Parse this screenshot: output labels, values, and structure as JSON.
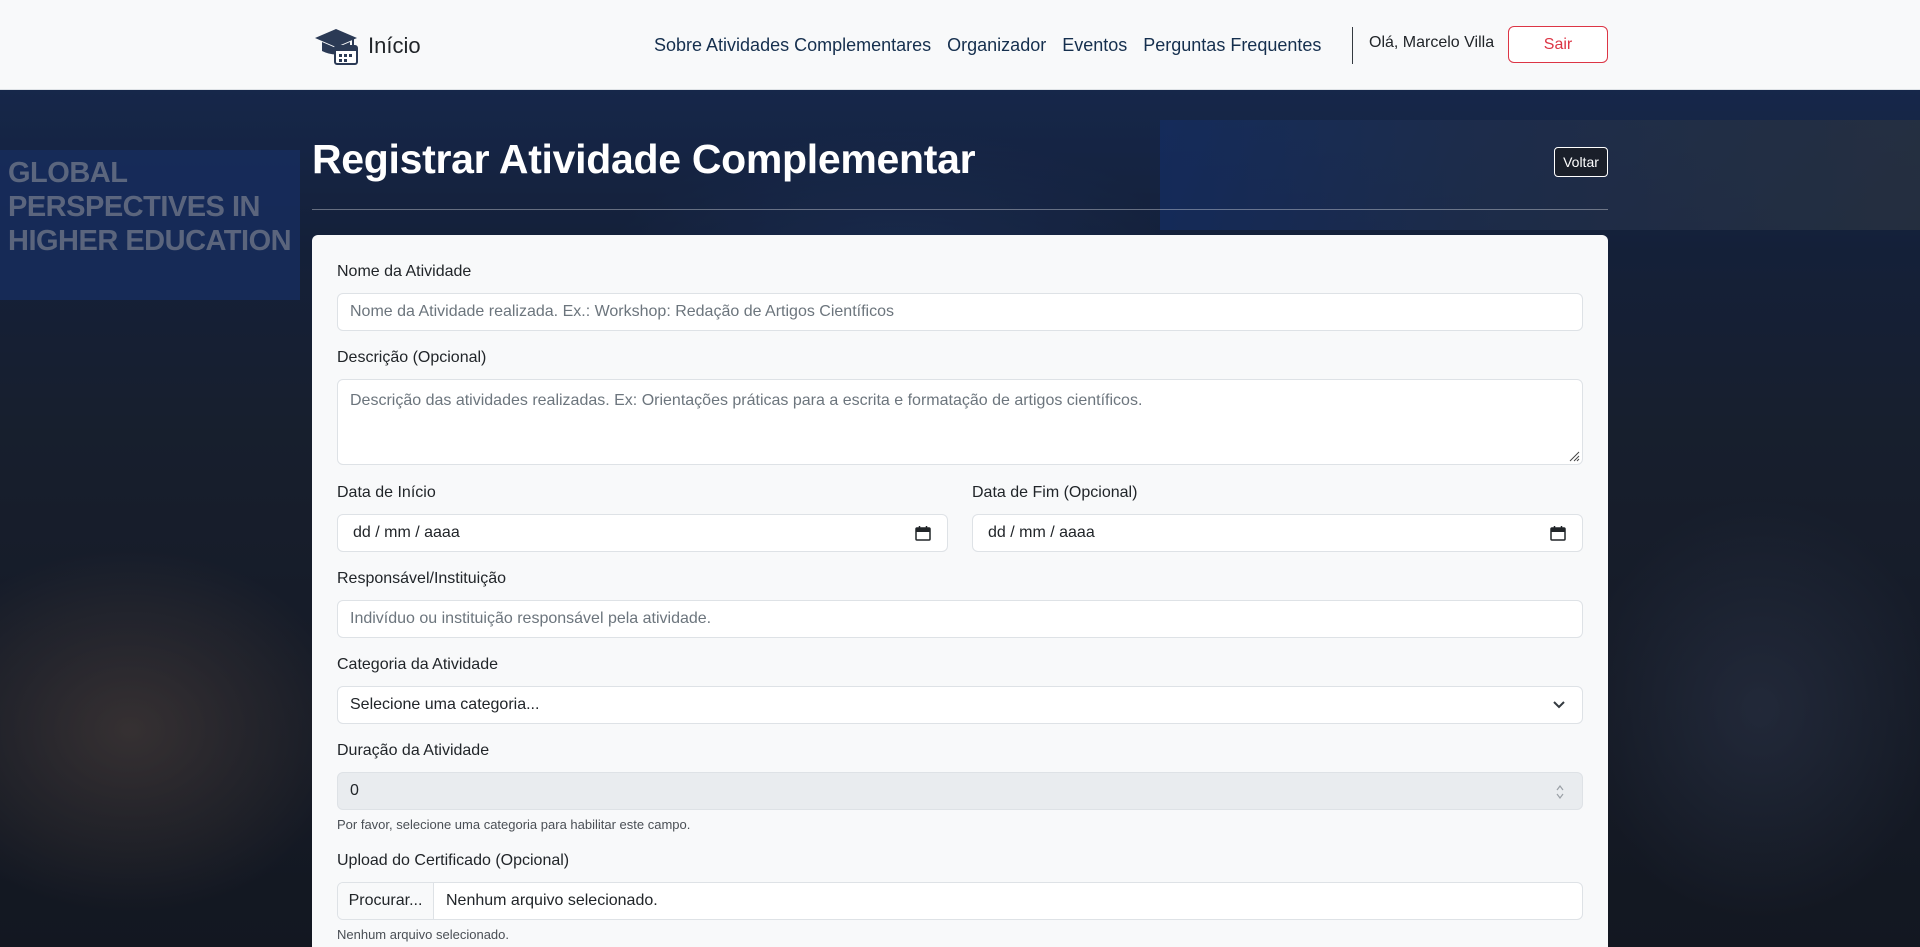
{
  "navbar": {
    "brand_label": "Início",
    "links": [
      "Sobre Atividades Complementares",
      "Organizador",
      "Eventos",
      "Perguntas Frequentes"
    ],
    "greeting": "Olá, Marcelo Villa",
    "logout_label": "Sair"
  },
  "background": {
    "banner_lines": [
      "GLOBAL",
      "PERSPECTIVES IN",
      "HIGHER EDUCATION"
    ]
  },
  "page": {
    "title": "Registrar Atividade Complementar",
    "back_label": "Voltar"
  },
  "form": {
    "name": {
      "label": "Nome da Atividade",
      "placeholder": "Nome da Atividade realizada. Ex.: Workshop: Redação de Artigos Científicos"
    },
    "description": {
      "label": "Descrição (Opcional)",
      "placeholder": "Descrição das atividades realizadas. Ex: Orientações práticas para a escrita e formatação de artigos científicos."
    },
    "start_date": {
      "label": "Data de Início",
      "value": "dd / mm / aaaa"
    },
    "end_date": {
      "label": "Data de Fim (Opcional)",
      "value": "dd / mm / aaaa"
    },
    "responsible": {
      "label": "Responsável/Instituição",
      "placeholder": "Indivíduo ou instituição responsável pela atividade."
    },
    "category": {
      "label": "Categoria da Atividade",
      "selected": "Selecione uma categoria..."
    },
    "duration": {
      "label": "Duração da Atividade",
      "value": "0",
      "help": "Por favor, selecione uma categoria para habilitar este campo."
    },
    "certificate": {
      "label": "Upload do Certificado (Opcional)",
      "button_label": "Procurar...",
      "file_name": "Nenhum arquivo selecionado.",
      "help": "Nenhum arquivo selecionado."
    }
  },
  "colors": {
    "danger": "#dc3545",
    "nav_link": "#152f4e",
    "navbar_bg": "#f8f9fa"
  }
}
